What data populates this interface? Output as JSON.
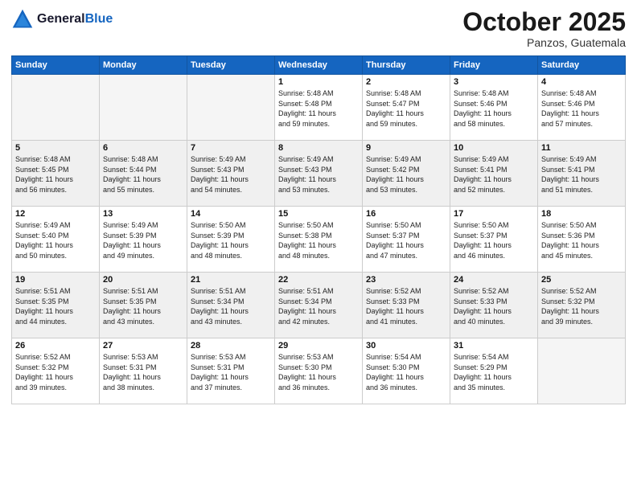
{
  "header": {
    "logo_line1": "General",
    "logo_line2": "Blue",
    "month": "October 2025",
    "location": "Panzos, Guatemala"
  },
  "weekdays": [
    "Sunday",
    "Monday",
    "Tuesday",
    "Wednesday",
    "Thursday",
    "Friday",
    "Saturday"
  ],
  "weeks": [
    [
      {
        "day": "",
        "info": ""
      },
      {
        "day": "",
        "info": ""
      },
      {
        "day": "",
        "info": ""
      },
      {
        "day": "1",
        "info": "Sunrise: 5:48 AM\nSunset: 5:48 PM\nDaylight: 11 hours\nand 59 minutes."
      },
      {
        "day": "2",
        "info": "Sunrise: 5:48 AM\nSunset: 5:47 PM\nDaylight: 11 hours\nand 59 minutes."
      },
      {
        "day": "3",
        "info": "Sunrise: 5:48 AM\nSunset: 5:46 PM\nDaylight: 11 hours\nand 58 minutes."
      },
      {
        "day": "4",
        "info": "Sunrise: 5:48 AM\nSunset: 5:46 PM\nDaylight: 11 hours\nand 57 minutes."
      }
    ],
    [
      {
        "day": "5",
        "info": "Sunrise: 5:48 AM\nSunset: 5:45 PM\nDaylight: 11 hours\nand 56 minutes."
      },
      {
        "day": "6",
        "info": "Sunrise: 5:48 AM\nSunset: 5:44 PM\nDaylight: 11 hours\nand 55 minutes."
      },
      {
        "day": "7",
        "info": "Sunrise: 5:49 AM\nSunset: 5:43 PM\nDaylight: 11 hours\nand 54 minutes."
      },
      {
        "day": "8",
        "info": "Sunrise: 5:49 AM\nSunset: 5:43 PM\nDaylight: 11 hours\nand 53 minutes."
      },
      {
        "day": "9",
        "info": "Sunrise: 5:49 AM\nSunset: 5:42 PM\nDaylight: 11 hours\nand 53 minutes."
      },
      {
        "day": "10",
        "info": "Sunrise: 5:49 AM\nSunset: 5:41 PM\nDaylight: 11 hours\nand 52 minutes."
      },
      {
        "day": "11",
        "info": "Sunrise: 5:49 AM\nSunset: 5:41 PM\nDaylight: 11 hours\nand 51 minutes."
      }
    ],
    [
      {
        "day": "12",
        "info": "Sunrise: 5:49 AM\nSunset: 5:40 PM\nDaylight: 11 hours\nand 50 minutes."
      },
      {
        "day": "13",
        "info": "Sunrise: 5:49 AM\nSunset: 5:39 PM\nDaylight: 11 hours\nand 49 minutes."
      },
      {
        "day": "14",
        "info": "Sunrise: 5:50 AM\nSunset: 5:39 PM\nDaylight: 11 hours\nand 48 minutes."
      },
      {
        "day": "15",
        "info": "Sunrise: 5:50 AM\nSunset: 5:38 PM\nDaylight: 11 hours\nand 48 minutes."
      },
      {
        "day": "16",
        "info": "Sunrise: 5:50 AM\nSunset: 5:37 PM\nDaylight: 11 hours\nand 47 minutes."
      },
      {
        "day": "17",
        "info": "Sunrise: 5:50 AM\nSunset: 5:37 PM\nDaylight: 11 hours\nand 46 minutes."
      },
      {
        "day": "18",
        "info": "Sunrise: 5:50 AM\nSunset: 5:36 PM\nDaylight: 11 hours\nand 45 minutes."
      }
    ],
    [
      {
        "day": "19",
        "info": "Sunrise: 5:51 AM\nSunset: 5:35 PM\nDaylight: 11 hours\nand 44 minutes."
      },
      {
        "day": "20",
        "info": "Sunrise: 5:51 AM\nSunset: 5:35 PM\nDaylight: 11 hours\nand 43 minutes."
      },
      {
        "day": "21",
        "info": "Sunrise: 5:51 AM\nSunset: 5:34 PM\nDaylight: 11 hours\nand 43 minutes."
      },
      {
        "day": "22",
        "info": "Sunrise: 5:51 AM\nSunset: 5:34 PM\nDaylight: 11 hours\nand 42 minutes."
      },
      {
        "day": "23",
        "info": "Sunrise: 5:52 AM\nSunset: 5:33 PM\nDaylight: 11 hours\nand 41 minutes."
      },
      {
        "day": "24",
        "info": "Sunrise: 5:52 AM\nSunset: 5:33 PM\nDaylight: 11 hours\nand 40 minutes."
      },
      {
        "day": "25",
        "info": "Sunrise: 5:52 AM\nSunset: 5:32 PM\nDaylight: 11 hours\nand 39 minutes."
      }
    ],
    [
      {
        "day": "26",
        "info": "Sunrise: 5:52 AM\nSunset: 5:32 PM\nDaylight: 11 hours\nand 39 minutes."
      },
      {
        "day": "27",
        "info": "Sunrise: 5:53 AM\nSunset: 5:31 PM\nDaylight: 11 hours\nand 38 minutes."
      },
      {
        "day": "28",
        "info": "Sunrise: 5:53 AM\nSunset: 5:31 PM\nDaylight: 11 hours\nand 37 minutes."
      },
      {
        "day": "29",
        "info": "Sunrise: 5:53 AM\nSunset: 5:30 PM\nDaylight: 11 hours\nand 36 minutes."
      },
      {
        "day": "30",
        "info": "Sunrise: 5:54 AM\nSunset: 5:30 PM\nDaylight: 11 hours\nand 36 minutes."
      },
      {
        "day": "31",
        "info": "Sunrise: 5:54 AM\nSunset: 5:29 PM\nDaylight: 11 hours\nand 35 minutes."
      },
      {
        "day": "",
        "info": ""
      }
    ]
  ]
}
